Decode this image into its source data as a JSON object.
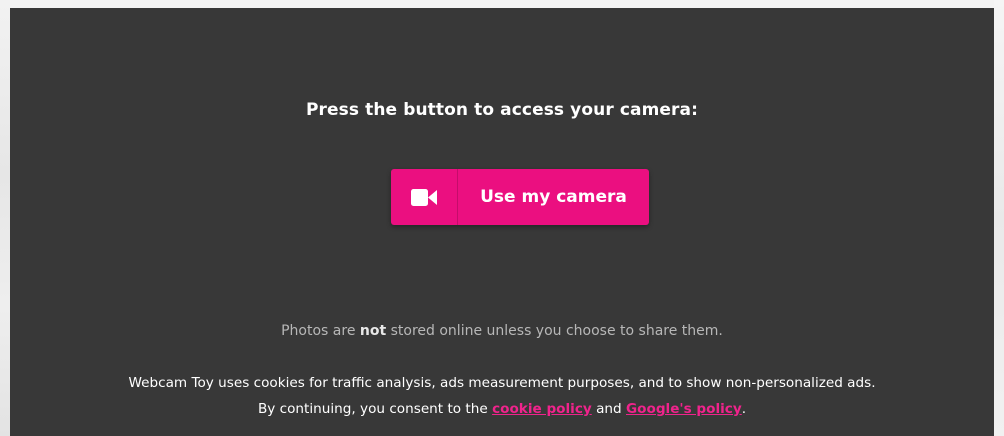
{
  "prompt": "Press the button to access your camera:",
  "camera_button": {
    "icon": "video-camera-icon",
    "label": "Use my camera"
  },
  "storage_note": {
    "before": "Photos are ",
    "emphasis": "not",
    "after": " stored online unless you choose to share them."
  },
  "cookie_notice": {
    "line1": "Webcam Toy uses cookies for traffic analysis, ads measurement purposes, and to show non-personalized ads.",
    "line2_before": "By continuing, you consent to the ",
    "cookie_link": "cookie policy",
    "middle": " and ",
    "google_link": "Google's policy",
    "end": "."
  },
  "colors": {
    "panel_background": "#383838",
    "accent": "#eb0f80",
    "link": "#f0238c"
  }
}
